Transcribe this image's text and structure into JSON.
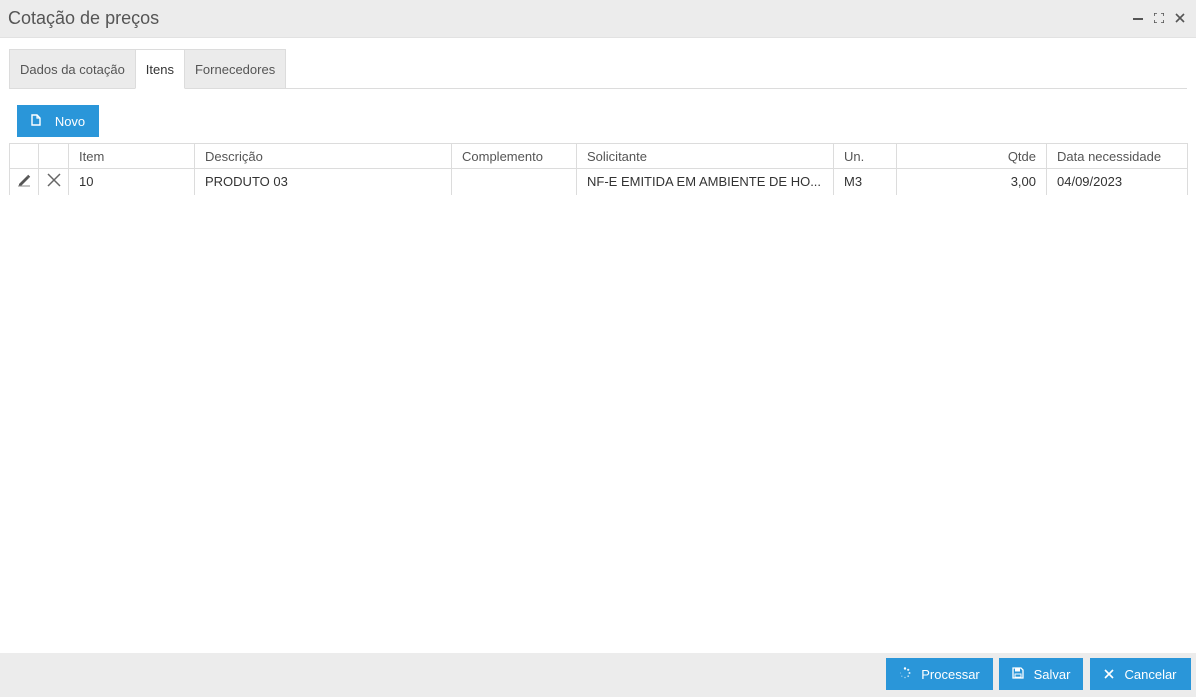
{
  "window": {
    "title": "Cotação de preços"
  },
  "tabs": [
    {
      "label": "Dados da cotação"
    },
    {
      "label": "Itens"
    },
    {
      "label": "Fornecedores"
    }
  ],
  "toolbar": {
    "new_label": "Novo"
  },
  "table": {
    "columns": [
      "Item",
      "Descrição",
      "Complemento",
      "Solicitante",
      "Un.",
      "Qtde",
      "Data necessidade"
    ],
    "rows": [
      {
        "item": "10",
        "descricao": "PRODUTO 03",
        "complemento": "",
        "solicitante": "NF-E EMITIDA EM AMBIENTE DE HO...",
        "un": "M3",
        "qtde": "3,00",
        "data": "04/09/2023"
      }
    ]
  },
  "footer": {
    "process_label": "Processar",
    "save_label": "Salvar",
    "cancel_label": "Cancelar"
  },
  "colors": {
    "accent": "#2a96d9",
    "bar_bg": "#ececec"
  }
}
